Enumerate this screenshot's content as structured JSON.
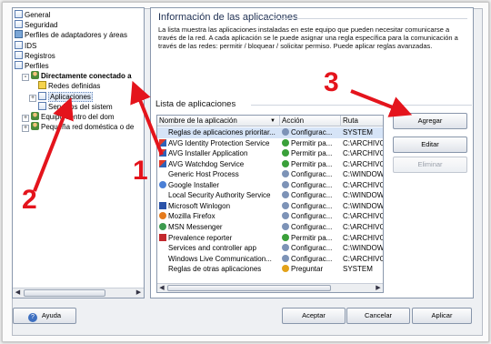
{
  "tree": {
    "items": [
      {
        "label": "General",
        "icon": "page-icon",
        "indent": 0,
        "bold": false
      },
      {
        "label": "Seguridad",
        "icon": "page-icon",
        "indent": 0,
        "bold": false
      },
      {
        "label": "Perfiles de adaptadores y áreas",
        "icon": "network-icon",
        "indent": 0,
        "bold": false
      },
      {
        "label": "IDS",
        "icon": "page-icon",
        "indent": 0,
        "bold": false
      },
      {
        "label": "Registros",
        "icon": "page-icon",
        "indent": 0,
        "bold": false
      },
      {
        "label": "Perfiles",
        "icon": "page-icon",
        "indent": 0,
        "bold": false
      },
      {
        "label": "Directamente conectado a",
        "icon": "user-icon",
        "indent": 1,
        "bold": true,
        "expander": "-"
      },
      {
        "label": "Redes definidas",
        "icon": "warning-icon",
        "indent": 2,
        "bold": false
      },
      {
        "label": "Aplicaciones",
        "icon": "page-icon",
        "indent": 2,
        "bold": false,
        "expander": "+",
        "selected": true
      },
      {
        "label": "Servicios del sistem",
        "icon": "page-icon",
        "indent": 2,
        "bold": false
      },
      {
        "label": "Equipo dentro del dom",
        "icon": "user-icon",
        "indent": 1,
        "bold": false,
        "expander": "+"
      },
      {
        "label": "Pequeña red doméstica o de",
        "icon": "user-icon",
        "indent": 1,
        "bold": false,
        "expander": "+"
      }
    ]
  },
  "main": {
    "title": "Información de las aplicaciones",
    "description": "La lista muestra las aplicaciones instaladas en este equipo que pueden necesitar comunicarse a través de la red. A cada aplicación se le puede asignar una regla específica para la comunicación a través de las redes: permitir / bloquear / solicitar permiso. Puede aplicar reglas avanzadas.",
    "list_title": "Lista de aplicaciones",
    "columns": [
      "Nombre de la aplicación",
      "Acción",
      "Ruta"
    ],
    "rows": [
      {
        "name": "Reglas de aplicaciones prioritar...",
        "name_icon": "blank",
        "action": "Configurac...",
        "action_icon": "config-icon",
        "path": "SYSTEM",
        "selected": true
      },
      {
        "name": "AVG Identity Protection Service",
        "name_icon": "avg-icon",
        "action": "Permitir pa...",
        "action_icon": "allow-icon",
        "path": "C:\\ARCHIVO"
      },
      {
        "name": "AVG Installer Application",
        "name_icon": "avg-icon",
        "action": "Permitir pa...",
        "action_icon": "allow-icon",
        "path": "C:\\ARCHIVO"
      },
      {
        "name": "AVG Watchdog Service",
        "name_icon": "avg-icon",
        "action": "Permitir pa...",
        "action_icon": "allow-icon",
        "path": "C:\\ARCHIVO"
      },
      {
        "name": "Generic Host Process",
        "name_icon": "blank",
        "action": "Configurac...",
        "action_icon": "config-icon",
        "path": "C:\\WINDOW"
      },
      {
        "name": "Google Installer",
        "name_icon": "google-icon",
        "action": "Configurac...",
        "action_icon": "config-icon",
        "path": "C:\\ARCHIVO"
      },
      {
        "name": "Local Security Authority Service",
        "name_icon": "blank",
        "action": "Configurac...",
        "action_icon": "config-icon",
        "path": "C:\\WINDOW"
      },
      {
        "name": "Microsoft Winlogon",
        "name_icon": "windows-icon",
        "action": "Configurac...",
        "action_icon": "config-icon",
        "path": "C:\\WINDOW"
      },
      {
        "name": "Mozilla Firefox",
        "name_icon": "firefox-icon",
        "action": "Configurac...",
        "action_icon": "config-icon",
        "path": "C:\\ARCHIVO"
      },
      {
        "name": "MSN Messenger",
        "name_icon": "msn-icon",
        "action": "Configurac...",
        "action_icon": "config-icon",
        "path": "C:\\ARCHIVO"
      },
      {
        "name": "Prevalence reporter",
        "name_icon": "prevalence-icon",
        "action": "Permitir pa...",
        "action_icon": "allow-icon",
        "path": "C:\\ARCHIVO"
      },
      {
        "name": "Services and controller app",
        "name_icon": "blank",
        "action": "Configurac...",
        "action_icon": "config-icon",
        "path": "C:\\WINDOW"
      },
      {
        "name": "Windows Live Communication...",
        "name_icon": "blank",
        "action": "Configurac...",
        "action_icon": "config-icon",
        "path": "C:\\ARCHIVO"
      },
      {
        "name": "Reglas de otras aplicaciones",
        "name_icon": "blank",
        "action": "Preguntar",
        "action_icon": "ask-icon",
        "path": "SYSTEM"
      }
    ],
    "buttons": {
      "add": "Agregar",
      "edit": "Editar",
      "delete": "Eliminar"
    }
  },
  "footer": {
    "help": "Ayuda",
    "accept": "Aceptar",
    "cancel": "Cancelar",
    "apply": "Aplicar"
  },
  "annotations": {
    "labels": [
      "1",
      "2",
      "3"
    ],
    "color": "#e4141c"
  }
}
